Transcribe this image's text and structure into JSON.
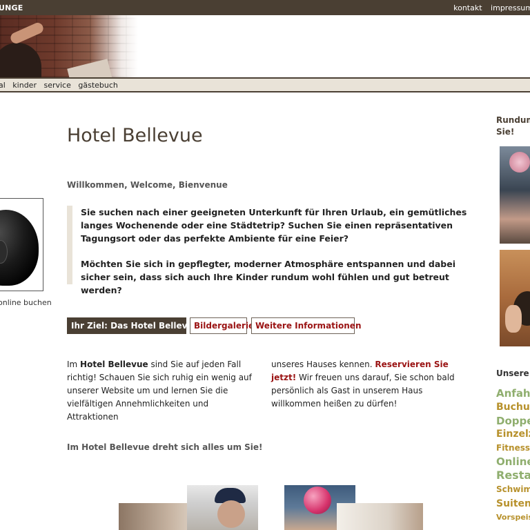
{
  "topbar": {
    "brand": "UNGE",
    "links": [
      "kontakt",
      "impressum"
    ]
  },
  "nav": {
    "items": [
      "al",
      "kinder",
      "service",
      "gästebuch"
    ]
  },
  "left": {
    "online_buchen": "online buchen"
  },
  "main": {
    "title": "Hotel Bellevue",
    "welcome": "Willkommen, Welcome, Bienvenue",
    "intro_p1": "Sie suchen nach einer geeigneten Unterkunft für Ihren Urlaub, ein gemütliches langes Wochenende oder eine Städtetrip? Suchen Sie einen repräsentativen Tagungsort oder das perfekte Ambiente für eine Feier?",
    "intro_p2": "Möchten Sie sich in gepflegter, moderner Atmosphäre entspannen und dabei sicher sein, dass sich auch Ihre Kinder rundum wohl fühlen und gut betreut werden?",
    "buttons": {
      "ziel": "Ihr Ziel: Das Hotel Bellevue",
      "galerie": "Bildergalerie",
      "info": "Weitere Informationen"
    },
    "col1": {
      "pre": "Im ",
      "hotel": "Hotel Bellevue",
      "rest": " sind Sie auf jeden Fall richtig! Schauen Sie sich ruhig ein wenig auf unserer Website um und lernen Sie die vielfältigen Annehmlichkeiten und Attraktionen"
    },
    "col2": {
      "pre": "unseres Hauses kennen. ",
      "reserve": "Reservieren Sie jetzt!",
      "rest": " Wir freuen uns darauf, Sie schon bald persönlich als Gast in unserem Haus willkommen heißen zu dürfen!"
    },
    "tagline": "Im Hotel Bellevue dreht sich alles um Sie!"
  },
  "right": {
    "rundum_l1": "Rundum",
    "rundum_l2": "Sie!",
    "unsere": "Unsere",
    "tags": [
      "Anfahrt",
      "Buchung",
      "Doppel",
      "Einzelzi",
      "Fitness",
      "Online",
      "Restau",
      "Schwim",
      "Suiten",
      "Vorspeis"
    ]
  },
  "colors": {
    "header_brown": "#4a3f33",
    "nav_beige": "#e9e3d8",
    "link_red": "#9a1313",
    "tag_green": "#8fae6e",
    "tag_gold": "#b7912c"
  }
}
